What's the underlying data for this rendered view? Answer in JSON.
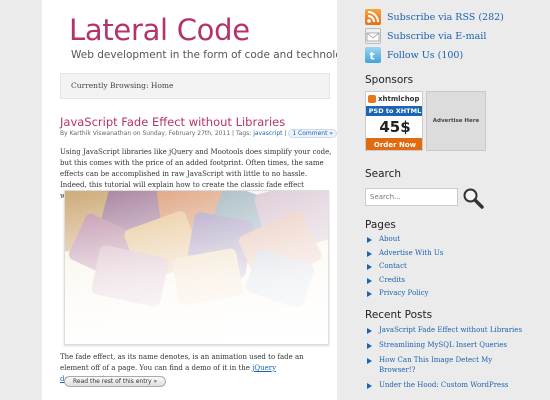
{
  "site": {
    "title": "Lateral Code",
    "tagline": "Web development in the form of code and technology"
  },
  "breadcrumb": "Currently Browsing: Home",
  "post": {
    "title": "JavaScript Fade Effect without Libraries",
    "meta_prefix": "By Karthik Viswanathan on Sunday, February 27th, 2011 | Tags: ",
    "tag": "javascript",
    "meta_sep": " | ",
    "comments": "1 Comment »",
    "intro": "Using JavaScript libraries like jQuery and Mootools does simplify your code, but this comes with the price of an added footprint. Often times, the same effects can be accomplished in raw JavaScript with little to no hassle. Indeed, this tutorial will explain how to create the classic fade effect without resorting to jQuery or Mootools.",
    "body_before_link": "The fade effect, as its name denotes, is an animation used to fade an element off of a page. You can find a demo of it in the ",
    "body_link": "jQuery documentation",
    "body_after_link": ".",
    "read_more": "Read the rest of this entry »"
  },
  "sidebar": {
    "subscribe": [
      {
        "icon": "rss-icon",
        "label": "Subscribe via RSS (282)"
      },
      {
        "icon": "mail-icon",
        "label": "Subscribe via E-mail"
      },
      {
        "icon": "twitter-icon",
        "label": "Follow Us (100)"
      }
    ],
    "sponsors_heading": "Sponsors",
    "ad1": {
      "logo": "xhtmlchop",
      "line1": "PSD to XHTML",
      "price": "45$",
      "cta": "Order Now"
    },
    "ad2": "Advertise Here",
    "search_heading": "Search",
    "search_placeholder": "Search...",
    "pages_heading": "Pages",
    "pages": [
      "About",
      "Advertise With Us",
      "Contact",
      "Credits",
      "Privacy Policy"
    ],
    "recent_heading": "Recent Posts",
    "recent": [
      "JavaScript Fade Effect without Libraries",
      "Streamlining MySQL Insert Queries",
      "How Can This Image Detect My Browser!?",
      "Under the Hood: Custom WordPress"
    ]
  },
  "colors": {
    "brand": "#b5336b",
    "link": "#1a63b0",
    "sidebar_bg": "#ebebeb",
    "content_bg": "#ffffff"
  }
}
